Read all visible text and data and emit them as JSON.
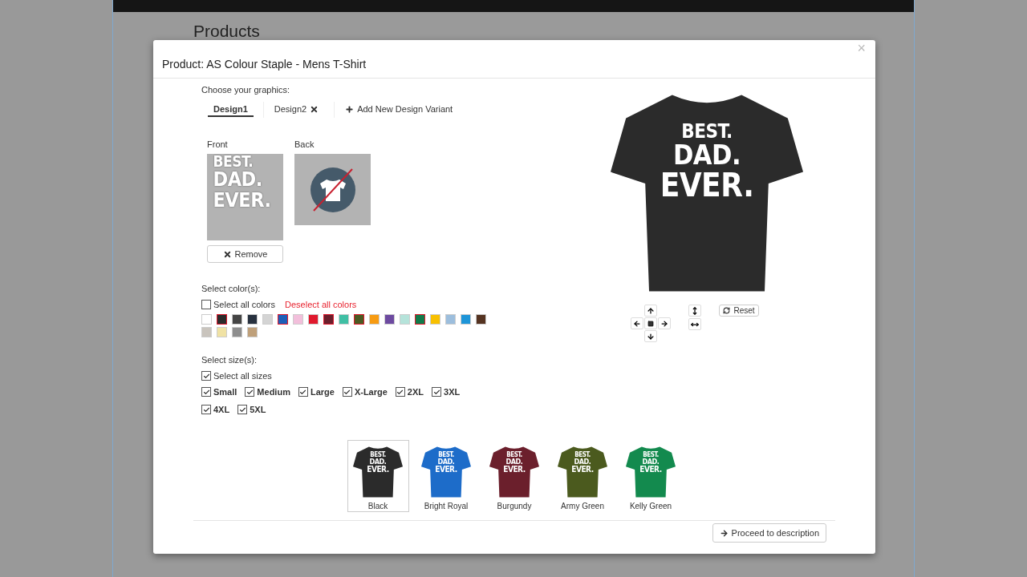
{
  "page": {
    "heading": "Products"
  },
  "modal": {
    "title": "Product: AS Colour Staple - Mens T-Shirt",
    "close": "×"
  },
  "graphics": {
    "label": "Choose your graphics:",
    "tabs": [
      {
        "label": "Design1",
        "selected": true,
        "removable": false
      },
      {
        "label": "Design2",
        "selected": false,
        "removable": true
      }
    ],
    "add_variant": "Add New Design Variant",
    "sides": [
      {
        "label": "Front",
        "kind": "design",
        "lines": [
          "BEST.",
          "DAD.",
          "EVER."
        ],
        "action": "Remove"
      },
      {
        "label": "Back",
        "kind": "empty"
      }
    ]
  },
  "colors": {
    "label": "Select color(s):",
    "select_all": {
      "label": "Select all colors",
      "checked": false
    },
    "deselect_all": "Deselect all colors",
    "swatches": [
      {
        "color": "#ffffff",
        "selected": false
      },
      {
        "color": "#2b2b2b",
        "selected": true
      },
      {
        "color": "#444444",
        "selected": false
      },
      {
        "color": "#27313f",
        "selected": false
      },
      {
        "color": "#d4d4d4",
        "selected": false
      },
      {
        "color": "#1d5fb8",
        "selected": true
      },
      {
        "color": "#f2bfdb",
        "selected": false
      },
      {
        "color": "#e0192d",
        "selected": false
      },
      {
        "color": "#6b1f2c",
        "selected": true
      },
      {
        "color": "#3fbfa4",
        "selected": false
      },
      {
        "color": "#4b5a22",
        "selected": true
      },
      {
        "color": "#f79b12",
        "selected": false
      },
      {
        "color": "#6d4aa0",
        "selected": false
      },
      {
        "color": "#b5e3da",
        "selected": false
      },
      {
        "color": "#127a4a",
        "selected": true
      },
      {
        "color": "#f8c000",
        "selected": false
      },
      {
        "color": "#9cbedd",
        "selected": false
      },
      {
        "color": "#1e95d8",
        "selected": false
      },
      {
        "color": "#553321",
        "selected": false
      },
      {
        "color": "#c9c4bd",
        "selected": false
      },
      {
        "color": "#f0e2a4",
        "selected": false
      },
      {
        "color": "#8e8e8e",
        "selected": false
      },
      {
        "color": "#bfa07a",
        "selected": false
      }
    ]
  },
  "sizes": {
    "label": "Select size(s):",
    "select_all": {
      "label": "Select all sizes",
      "checked": true
    },
    "options": [
      {
        "label": "Small",
        "checked": true
      },
      {
        "label": "Medium",
        "checked": true
      },
      {
        "label": "Large",
        "checked": true
      },
      {
        "label": "X-Large",
        "checked": true
      },
      {
        "label": "2XL",
        "checked": true
      },
      {
        "label": "3XL",
        "checked": true
      },
      {
        "label": "4XL",
        "checked": true
      },
      {
        "label": "5XL",
        "checked": true
      }
    ]
  },
  "preview": {
    "color": "#2b2b2b",
    "lines": [
      "BEST.",
      "DAD.",
      "EVER."
    ],
    "reset": "Reset"
  },
  "variants": [
    {
      "name": "Black",
      "color": "#2b2b2b",
      "selected": true,
      "lines": [
        "BEST.",
        "DAD.",
        "EVER."
      ]
    },
    {
      "name": "Bright Royal",
      "color": "#1d6cc9",
      "selected": false,
      "lines": [
        "BEST.",
        "DAD.",
        "EVER."
      ]
    },
    {
      "name": "Burgundy",
      "color": "#6b1f2c",
      "selected": false,
      "lines": [
        "BEST.",
        "DAD.",
        "EVER."
      ]
    },
    {
      "name": "Army Green",
      "color": "#4b5a1e",
      "selected": false,
      "lines": [
        "BEST.",
        "DAD.",
        "EVER."
      ]
    },
    {
      "name": "Kelly Green",
      "color": "#138a4e",
      "selected": false,
      "lines": [
        "BEST.",
        "DAD.",
        "EVER."
      ]
    }
  ],
  "footer": {
    "proceed": "Proceed to description"
  }
}
